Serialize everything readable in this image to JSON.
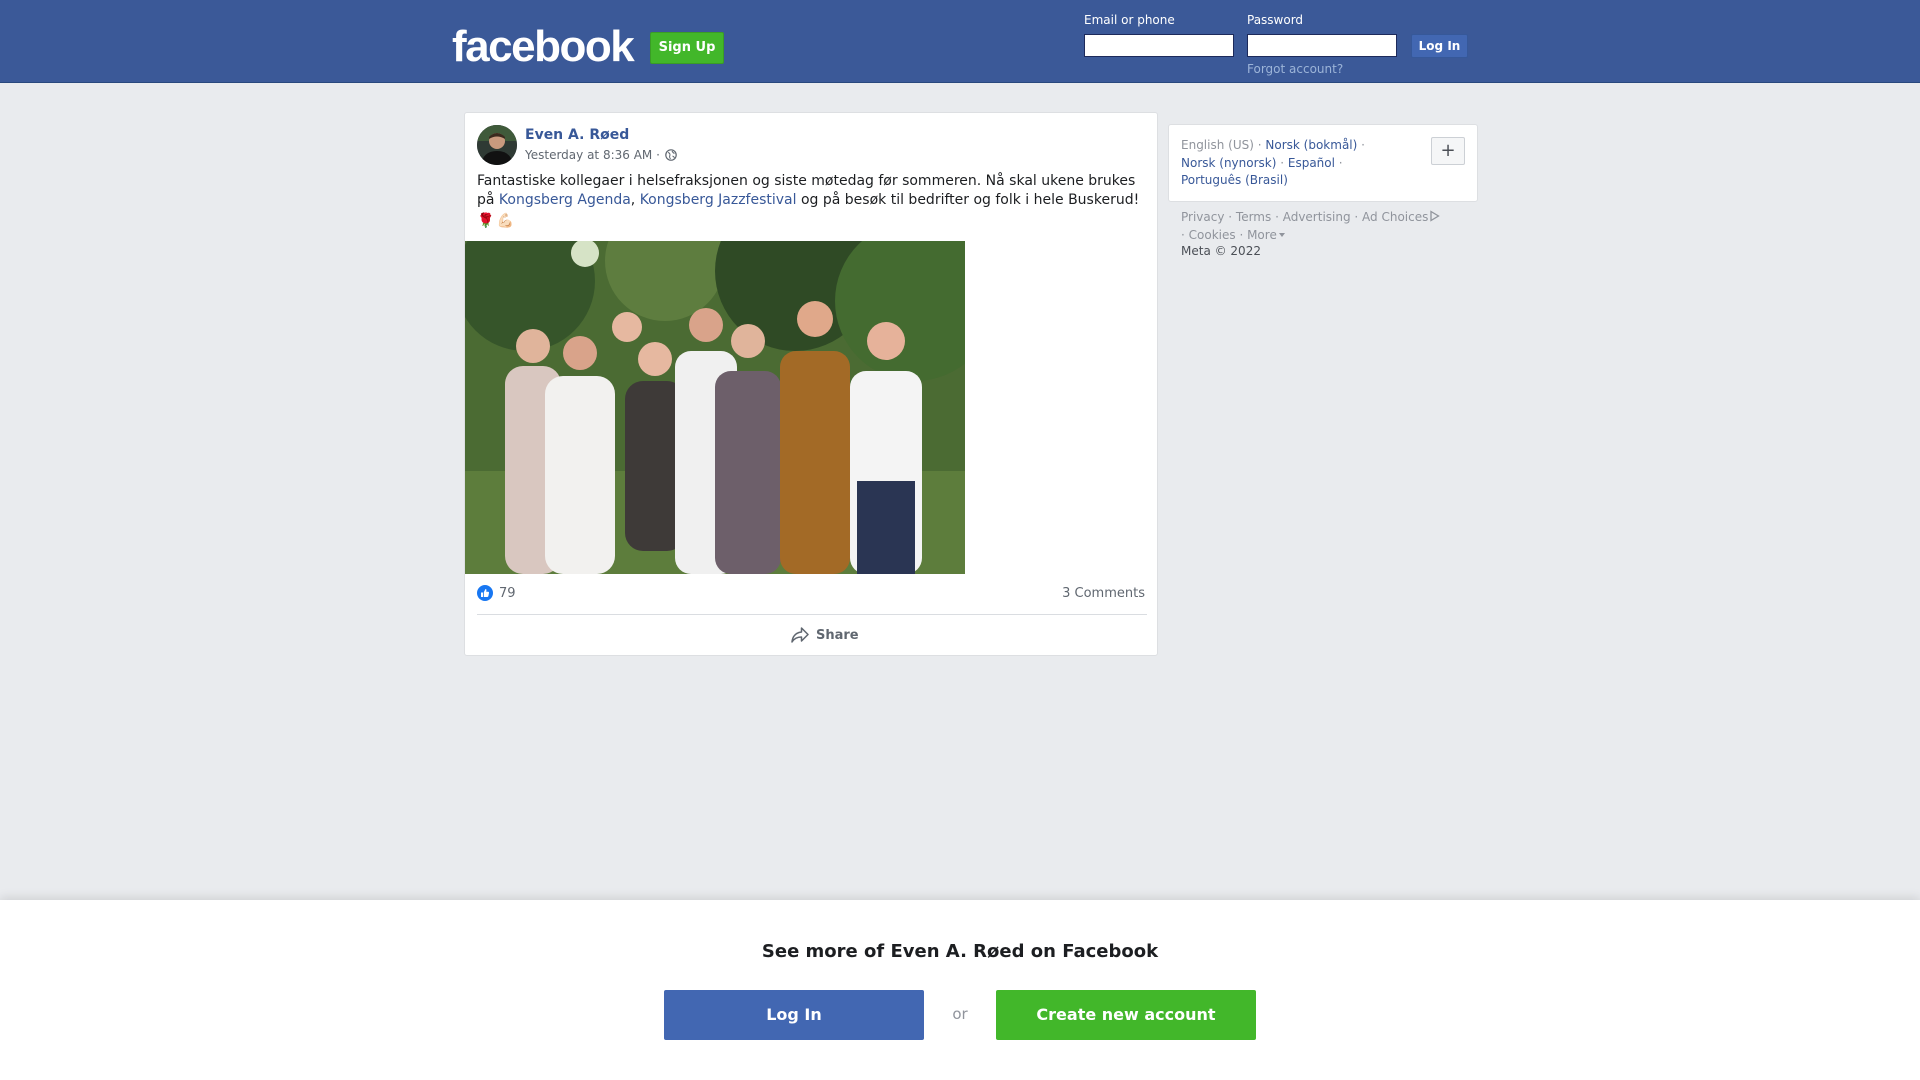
{
  "header": {
    "logo_text": "facebook",
    "signup_label": "Sign Up",
    "email_label": "Email or phone",
    "password_label": "Password",
    "email_value": "",
    "password_value": "",
    "login_label": "Log In",
    "forgot_label": "Forgot account?"
  },
  "post": {
    "author": "Even A. Røed",
    "timestamp": "Yesterday at 8:36 AM ·",
    "text_part1": "Fantastiske kollegaer i helsefraksjonen og siste møtedag før sommeren. Nå skal ukene brukes på ",
    "link1": "Kongsberg Agenda",
    "text_sep": ", ",
    "link2": "Kongsberg Jazzfestival",
    "text_part2": " og på besøk til bedrifter og folk i hele Buskerud!",
    "emoji1": "🌹",
    "emoji2": "💪🏻",
    "like_count": "79",
    "comments": "3 Comments",
    "share_label": "Share"
  },
  "languages": {
    "current": "English (US)",
    "items": [
      "Norsk (bokmål)",
      "Norsk (nynorsk)",
      "Español",
      "Português (Brasil)"
    ],
    "more_button": "+"
  },
  "footer": {
    "links": [
      "Privacy",
      "Terms",
      "Advertising",
      "Ad Choices",
      "Cookies",
      "More"
    ],
    "copyright": "Meta © 2022"
  },
  "banner": {
    "title": "See more of Even A. Røed on Facebook",
    "login_label": "Log In",
    "or_label": "or",
    "create_label": "Create new account"
  },
  "colors": {
    "brand_blue": "#3b5998",
    "button_blue": "#4267b2",
    "green": "#42b72a",
    "link": "#385898"
  }
}
